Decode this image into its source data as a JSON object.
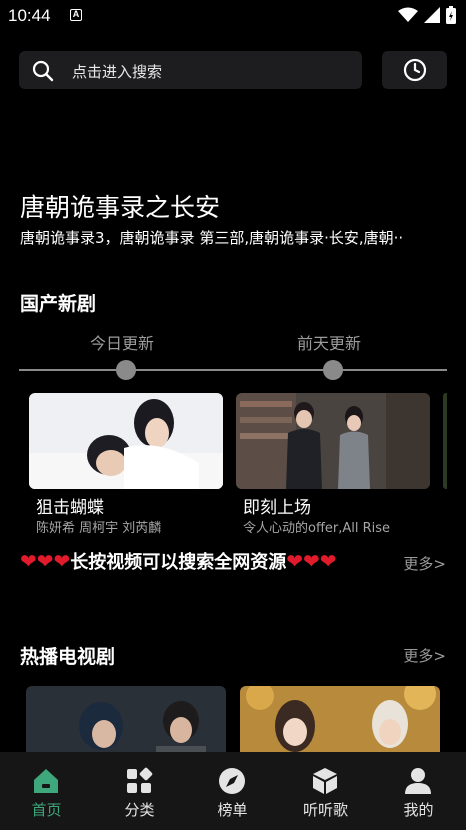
{
  "status_bar": {
    "time": "10:44",
    "notification_icon": "A"
  },
  "search": {
    "placeholder": "点击进入搜索"
  },
  "banner": {
    "title": "唐朝诡事录之长安",
    "subtitle": "唐朝诡事录3，唐朝诡事录  第三部,唐朝诡事录·长安,唐朝··"
  },
  "domestic_section": {
    "title": "国产新剧",
    "tabs": [
      "今日更新",
      "前天更新"
    ],
    "cards": [
      {
        "title": "狙击蝴蝶",
        "cast": "陈妍希 周柯宇 刘芮麟"
      },
      {
        "title": "即刻上场",
        "cast": "令人心动的offer,All Rise"
      }
    ],
    "notice": {
      "hearts_left": "❤❤❤",
      "text": "长按视频可以搜索全网资源",
      "hearts_right": "❤❤❤"
    },
    "more_label": "更多>"
  },
  "hot_section": {
    "title": "热播电视剧",
    "more_label": "更多>"
  },
  "bottom_nav": [
    {
      "label": "首页",
      "icon": "home-icon",
      "active": true
    },
    {
      "label": "分类",
      "icon": "category-icon",
      "active": false
    },
    {
      "label": "榜单",
      "icon": "compass-icon",
      "active": false
    },
    {
      "label": "听听歌",
      "icon": "cube-icon",
      "active": false
    },
    {
      "label": "我的",
      "icon": "user-icon",
      "active": false
    }
  ],
  "colors": {
    "accent": "#3ea77b",
    "heart": "#e21b2c",
    "panel": "#1d1d1f"
  }
}
